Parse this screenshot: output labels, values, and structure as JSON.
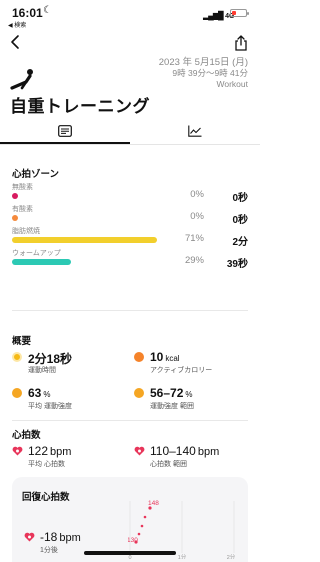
{
  "status": {
    "time": "16:01",
    "back_app": "◀ 検索",
    "network": "4G"
  },
  "header": {
    "date_line1": "2023 年 5月15日 (月)",
    "date_line2": "9時 39分〜9時 41分",
    "type": "Workout",
    "title": "自重トレーニング"
  },
  "tabs": [
    {
      "icon": "summary-icon"
    },
    {
      "icon": "chart-icon"
    }
  ],
  "zones": {
    "title": "心拍ゾーン",
    "items": [
      {
        "label": "無酸素",
        "pct": "0%",
        "time": "0秒",
        "color": "#d81b60",
        "fraction": 0
      },
      {
        "label": "有酸素",
        "pct": "0%",
        "time": "0秒",
        "color": "#f58a3c",
        "fraction": 0
      },
      {
        "label": "脂肪燃焼",
        "pct": "71%",
        "time": "2分",
        "color": "#f2cf2c",
        "fraction": 0.71
      },
      {
        "label": "ウォームアップ",
        "pct": "29%",
        "time": "39秒",
        "color": "#2cc9b4",
        "fraction": 0.29
      }
    ]
  },
  "summary": {
    "title": "概要",
    "duration": {
      "value": "2分18秒",
      "label": "運動時間"
    },
    "calories": {
      "value": "10",
      "unit": "kcal",
      "label": "アクティブカロリー"
    },
    "intensity": {
      "value": "63",
      "unit": "%",
      "label": "平均 運動強度"
    },
    "intensity_range": {
      "value": "56–72",
      "unit": "%",
      "label": "運動強度 範囲"
    }
  },
  "heart": {
    "title": "心拍数",
    "avg": {
      "value": "122",
      "unit": "bpm",
      "label": "平均 心拍数"
    },
    "range": {
      "value": "110–140",
      "unit": "bpm",
      "label": "心拍数 範囲"
    }
  },
  "recovery": {
    "title": "回復心拍数",
    "value": "-18",
    "unit": "bpm",
    "label": "1分後",
    "peak_label": "148",
    "low_label": "130",
    "axis": [
      "0",
      "1分",
      "2分"
    ]
  },
  "colors": {
    "accent_red": "#e8355a",
    "accent_orange": "#f5832a",
    "accent_yellow": "#f5b915"
  }
}
